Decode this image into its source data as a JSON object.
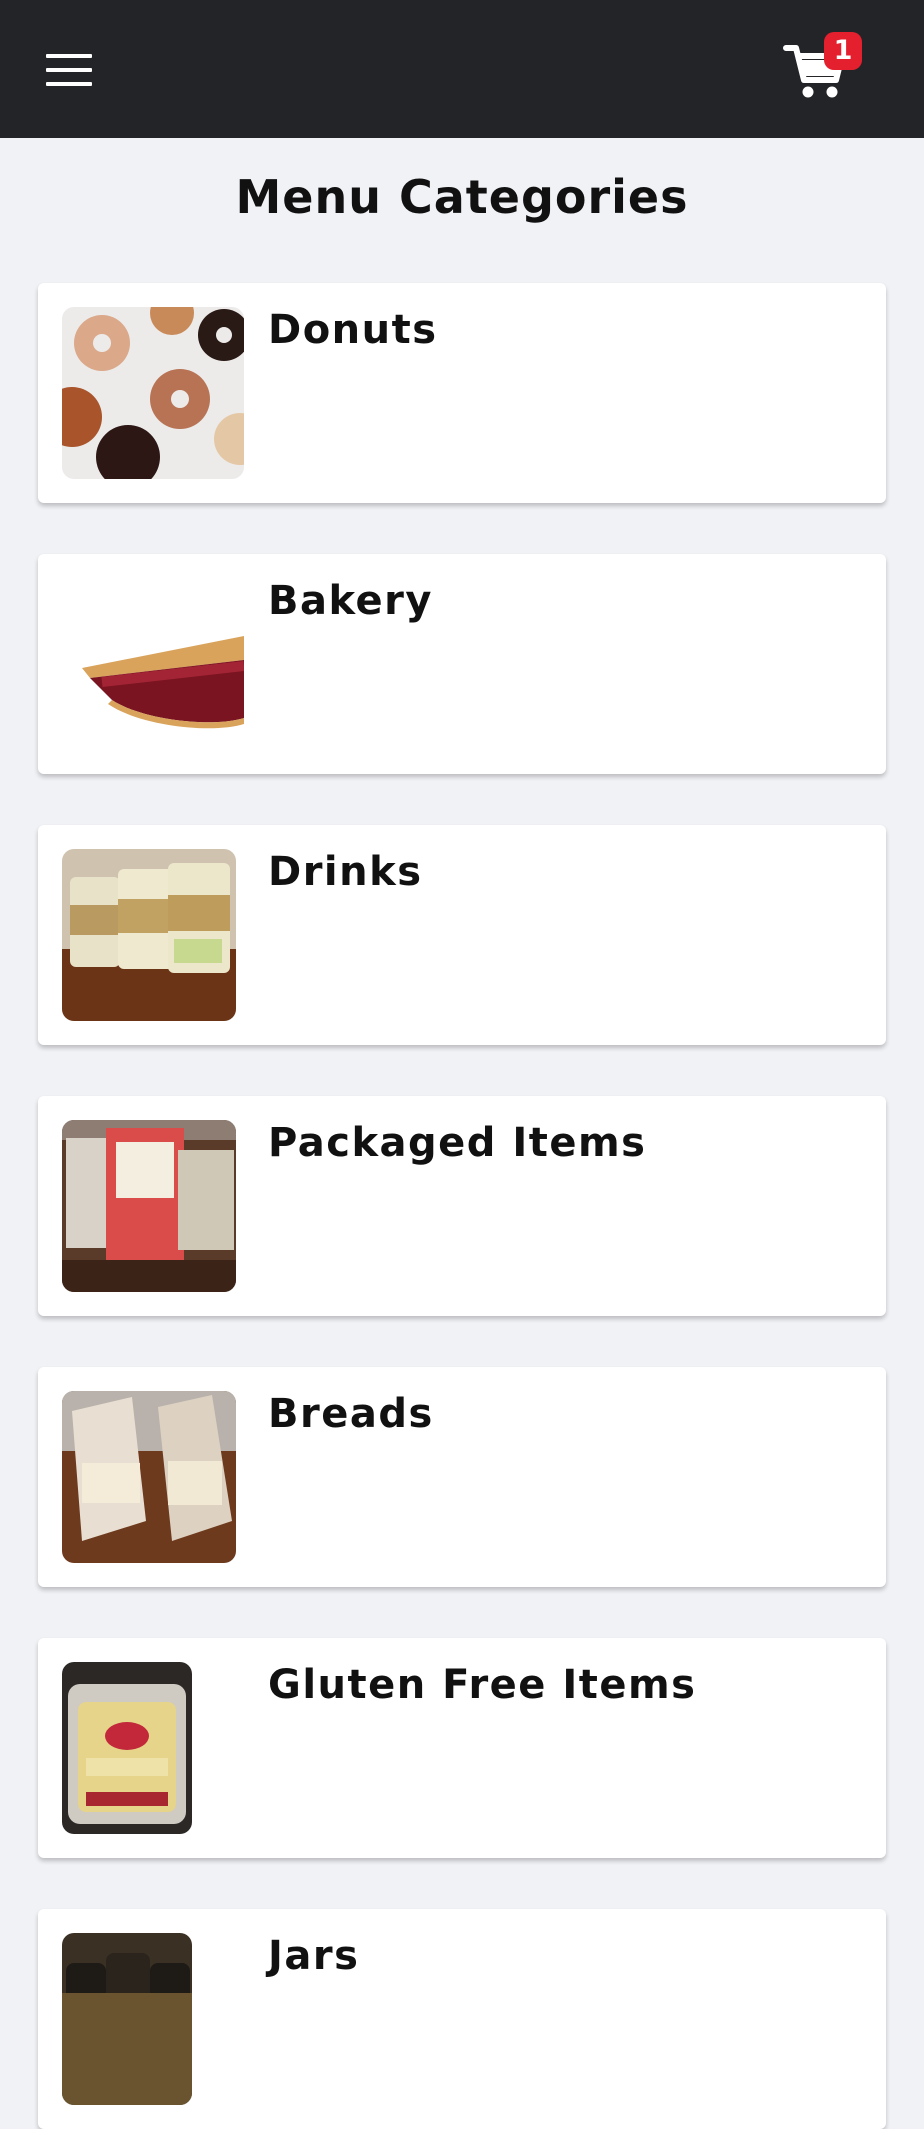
{
  "header": {
    "menu_icon": "hamburger-menu-icon",
    "cart_icon": "shopping-cart-icon",
    "cart_count": "1",
    "background": "#232428",
    "badge_color": "#e4202f"
  },
  "page": {
    "title": "Menu Categories"
  },
  "categories": [
    {
      "label": "Donuts",
      "image": "donuts-photo"
    },
    {
      "label": "Bakery",
      "image": "cherry-pie-slice-photo"
    },
    {
      "label": "Drinks",
      "image": "coffee-cups-photo"
    },
    {
      "label": "Packaged Items",
      "image": "packaged-pastries-photo"
    },
    {
      "label": "Breads",
      "image": "bagged-breads-photo"
    },
    {
      "label": "Gluten Free Items",
      "image": "gluten-free-muffins-photo"
    },
    {
      "label": "Jars",
      "image": "jars-photo"
    }
  ]
}
